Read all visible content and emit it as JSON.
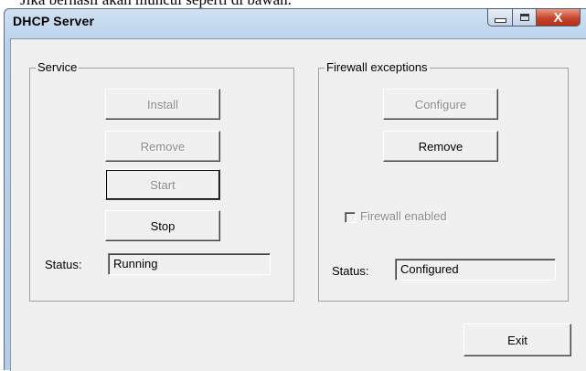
{
  "background_caption": "Jika berhasil akan muncul seperti di bawah.",
  "window": {
    "title": "DHCP Server",
    "controls": {
      "close_glyph": "X"
    }
  },
  "service": {
    "legend": "Service",
    "buttons": {
      "install": "Install",
      "remove": "Remove",
      "start": "Start",
      "stop": "Stop"
    },
    "status_label": "Status:",
    "status_value": "Running"
  },
  "firewall": {
    "legend": "Firewall exceptions",
    "buttons": {
      "configure": "Configure",
      "remove": "Remove"
    },
    "checkbox_label": "Firewall enabled",
    "checkbox_checked": false,
    "status_label": "Status:",
    "status_value": "Configured"
  },
  "footer": {
    "exit": "Exit"
  },
  "icons": [
    "minimize-icon",
    "maximize-icon",
    "close-icon"
  ]
}
